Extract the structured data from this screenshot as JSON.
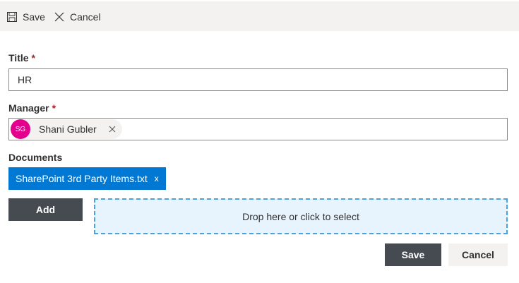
{
  "command_bar": {
    "save_label": "Save",
    "cancel_label": "Cancel"
  },
  "form": {
    "title": {
      "label": "Title",
      "required_mark": "*",
      "value": "HR"
    },
    "manager": {
      "label": "Manager",
      "required_mark": "*",
      "person": {
        "initials": "SG",
        "name": "Shani Gubler",
        "avatar_color": "#e3008c"
      }
    },
    "documents": {
      "label": "Documents",
      "files": [
        {
          "name": "SharePoint 3rd Party Items.txt",
          "remove_label": "x"
        }
      ],
      "add_label": "Add",
      "dropzone_text": "Drop here or click to select"
    }
  },
  "footer": {
    "save_label": "Save",
    "cancel_label": "Cancel"
  },
  "colors": {
    "accent": "#0078d4",
    "dark_button": "#464b52",
    "required": "#a4262c",
    "dropzone_border": "#4aa3df"
  }
}
